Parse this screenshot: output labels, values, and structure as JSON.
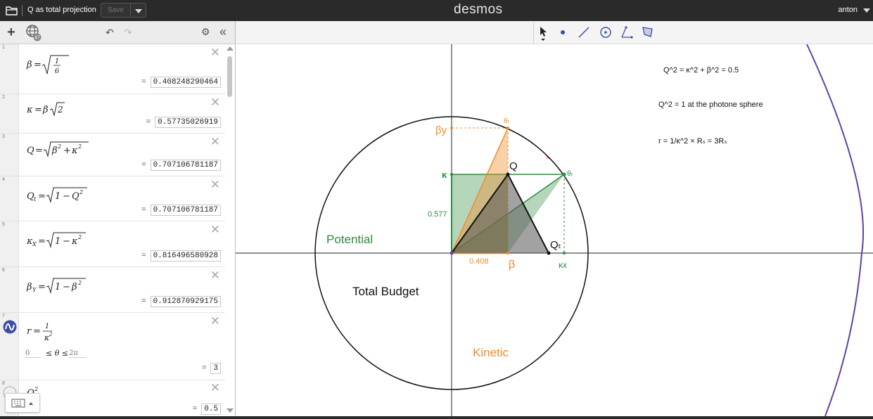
{
  "topbar": {
    "title": "Q as total projection",
    "save_label": "Save",
    "logo": "desmos",
    "user": "anton"
  },
  "expressions": [
    {
      "index": "1",
      "result": "0.408248290464"
    },
    {
      "index": "2",
      "result": "0.57735026919"
    },
    {
      "index": "3",
      "result": "0.707106781187"
    },
    {
      "index": "4",
      "result": "0.707106781187"
    },
    {
      "index": "5",
      "result": "0.816496580928"
    },
    {
      "index": "6",
      "result": "0.912870929175"
    },
    {
      "index": "7",
      "result": "3",
      "domain_min": "0",
      "domain_max": "2π"
    },
    {
      "index": "8",
      "result": "0.5"
    }
  ],
  "graph": {
    "notes": [
      "Q^2 = κ^2 + β^2 = 0.5",
      "Q^2 = 1 at the photone sphere",
      "r = 1/κ^2 × Rₛ = 3Rₛ"
    ],
    "labels": {
      "potential": "Potential",
      "kinetic": "Kinetic",
      "total_budget": "Total Budget",
      "Q": "Q",
      "Qt": "Qₜ",
      "beta": "β",
      "beta_y": "βy",
      "kappa": "κ",
      "kappa_x": "κx",
      "theta_1": "θₜ",
      "theta_2": "θₜ",
      "val_0408": "0.408",
      "val_0577": "0.577"
    },
    "colors": {
      "green": "#2d8a3e",
      "orange": "#f08c28",
      "purple": "#6042a6",
      "black": "#000000"
    }
  }
}
